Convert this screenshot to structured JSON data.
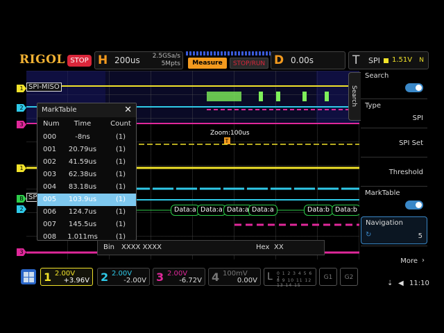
{
  "header": {
    "brand": "RIGOL",
    "run_state": "STOP",
    "horizontal": {
      "letter": "H",
      "timebase": "200us",
      "sample_rate": "2.5GSa/s",
      "memory": "5Mpts"
    },
    "measure_label": "Measure",
    "stoprun_label": "STOP/RUN",
    "delay": {
      "letter": "D",
      "value": "0.00s"
    },
    "trigger": {
      "letter": "T",
      "source": "SPI",
      "level": "1.51V",
      "mode": "N"
    }
  },
  "scope": {
    "zoom_label": "Zoom:100us",
    "channel_labels": {
      "miso": "SPI-MISO",
      "spi": "SPI"
    },
    "decode_packets": [
      "Data:a",
      "Data:a",
      "Data:a",
      "Data:a",
      "Data:b",
      "Data:b"
    ],
    "marker_t": "T"
  },
  "marktable": {
    "title": "MarkTable",
    "columns": [
      "Num",
      "Time",
      "Count"
    ],
    "rows": [
      {
        "num": "000",
        "time": "-8ns",
        "count": "(1)"
      },
      {
        "num": "001",
        "time": "20.79us",
        "count": "(1)"
      },
      {
        "num": "002",
        "time": "41.59us",
        "count": "(1)"
      },
      {
        "num": "003",
        "time": "62.38us",
        "count": "(1)"
      },
      {
        "num": "004",
        "time": "83.18us",
        "count": "(1)"
      },
      {
        "num": "005",
        "time": "103.9us",
        "count": "(1)"
      },
      {
        "num": "006",
        "time": "124.7us",
        "count": "(1)"
      },
      {
        "num": "007",
        "time": "145.5us",
        "count": "(1)"
      },
      {
        "num": "008",
        "time": "1.011ms",
        "count": "(1)"
      }
    ],
    "selected_index": 5
  },
  "binbar": {
    "bin_label": "Bin",
    "bin_value": "XXXX XXXX",
    "hex_label": "Hex",
    "hex_value": "XX"
  },
  "rightpanel": {
    "search_tab": "Search",
    "search_label": "Search",
    "search_on": true,
    "type_label": "Type",
    "type_value": "SPI",
    "spi_set": "SPI Set",
    "threshold": "Threshold",
    "marktable_label": "MarkTable",
    "marktable_on": true,
    "navigation_label": "Navigation",
    "navigation_value": "5",
    "more": "More"
  },
  "channels": [
    {
      "num": "1",
      "scale": "2.00V",
      "offset": "+3.96V",
      "color": "#f2e32a"
    },
    {
      "num": "2",
      "scale": "2.00V",
      "offset": "-2.00V",
      "color": "#2fc9e8"
    },
    {
      "num": "3",
      "scale": "2.00V",
      "offset": "-6.72V",
      "color": "#e0289a"
    },
    {
      "num": "4",
      "scale": "100mV",
      "offset": "0.00V",
      "color": "#777777"
    }
  ],
  "logic": {
    "letter": "L",
    "digits_row1": "0 1 2 3 4 5 6 7",
    "digits_row2": "8 9 10 11 12 13 14 15"
  },
  "generators": [
    "G1",
    "G2"
  ],
  "status": {
    "time": "11:10"
  }
}
